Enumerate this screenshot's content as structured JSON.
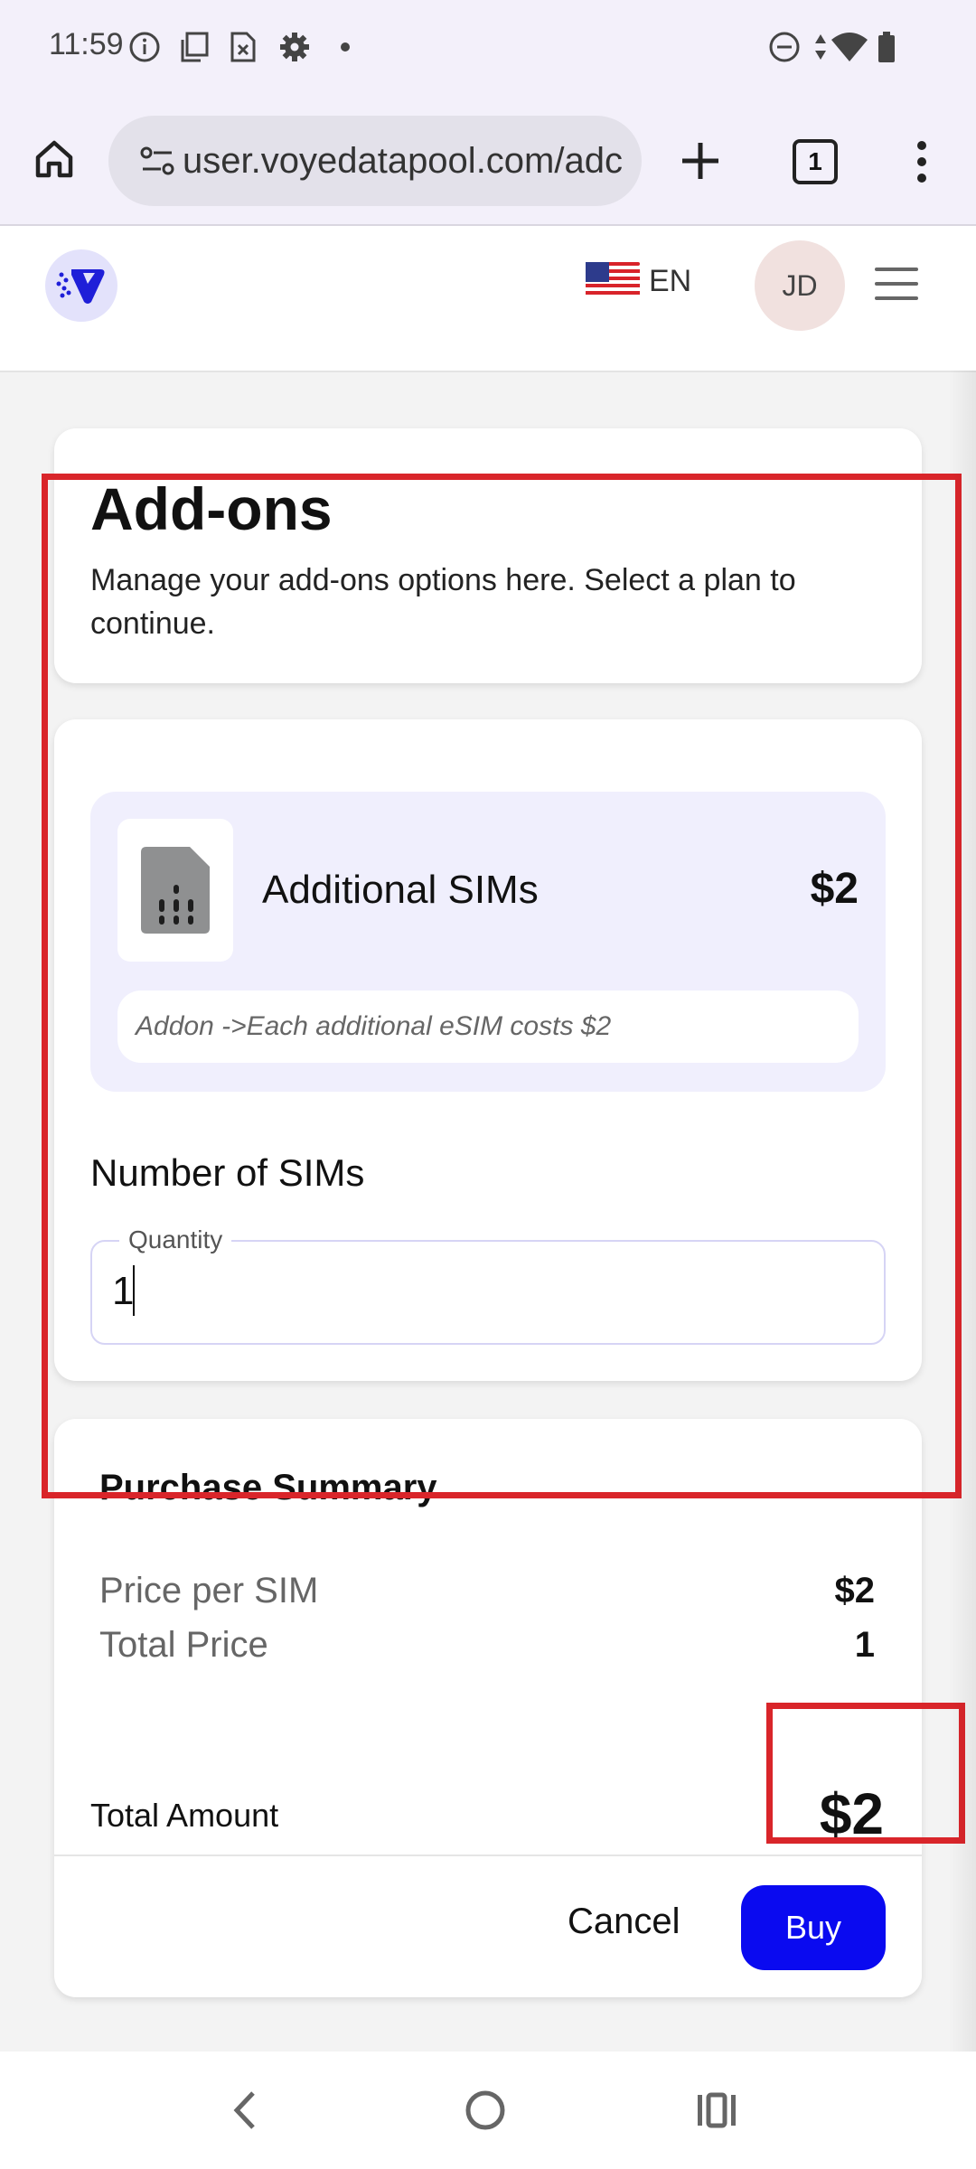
{
  "status_bar": {
    "time": "11:59"
  },
  "browser": {
    "url": "user.voyedatapool.com/adc",
    "tab_count": "1"
  },
  "header": {
    "language": "EN",
    "avatar_initials": "JD"
  },
  "page": {
    "title": "Add-ons",
    "subtitle": "Manage your add-ons options here. Select a plan to continue."
  },
  "addon": {
    "name": "Additional SIMs",
    "price": "$2",
    "description": "Addon ->Each additional eSIM costs $2"
  },
  "quantity_section": {
    "label": "Number of SIMs",
    "field_label": "Quantity",
    "value": "1"
  },
  "summary": {
    "title": "Purchase Summary",
    "rows": [
      {
        "label": "Price per SIM",
        "value": "$2"
      },
      {
        "label": "Total Price",
        "value": "1"
      }
    ],
    "total_label": "Total Amount",
    "total_value": "$2"
  },
  "actions": {
    "cancel_label": "Cancel",
    "buy_label": "Buy"
  },
  "colors": {
    "accent": "#0a0af0",
    "highlight": "#d9252a",
    "sim_card_bg": "#f0effd"
  }
}
